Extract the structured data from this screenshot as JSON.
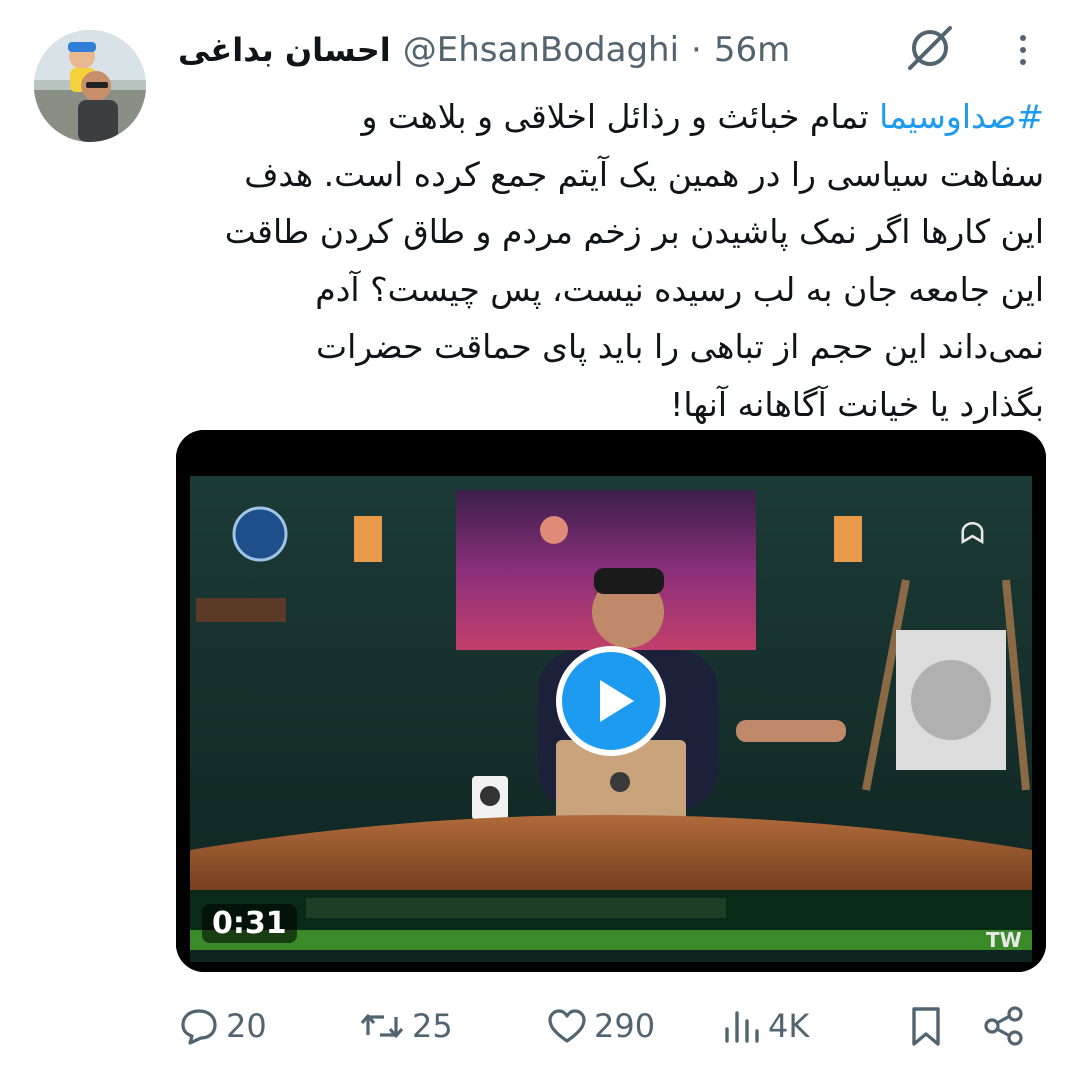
{
  "tweet": {
    "display_name": "احسان بداغی",
    "handle": "@EhsanBodaghi",
    "separator": "·",
    "time": "56m",
    "hashtag": "#صداوسیما",
    "lines": [
      " تمام خبائث و رذائل اخلاقی و بلاهت و",
      "سفاهت سیاسی را در همین یک آیتم جمع کرده است. هدف",
      "این کارها اگر نمک پاشیدن بر زخم مردم و طاق کردن طاقت",
      "این جامعه جان به لب رسیده نیست، پس چیست؟ آدم",
      "نمی‌داند این حجم از تباهی را باید پای حماقت حضرات",
      "بگذارد یا خیانت آگاهانه آنها!"
    ]
  },
  "video": {
    "duration": "0:31",
    "watermark": "TW"
  },
  "actions": {
    "replies": "20",
    "reposts": "25",
    "likes": "290",
    "views": "4K"
  },
  "icons": {
    "header": [
      "grok-icon",
      "more-icon"
    ],
    "actions": [
      "reply-icon",
      "repost-icon",
      "like-icon",
      "views-icon",
      "bookmark-icon",
      "share-icon"
    ]
  },
  "colors": {
    "accent": "#1d9bf0",
    "text": "#0f1419",
    "secondary": "#536471"
  }
}
